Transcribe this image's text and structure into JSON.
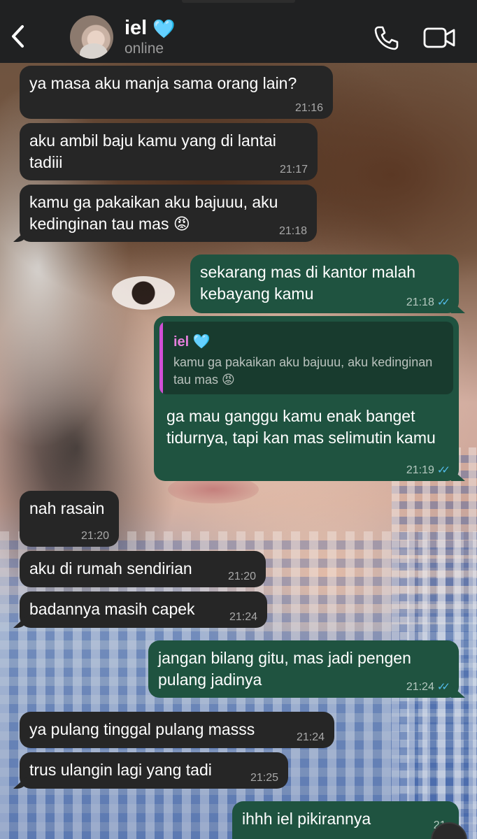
{
  "header": {
    "contact_name": "iel",
    "contact_emoji": "🩵",
    "status": "online",
    "back_icon": "chevron-left-icon",
    "call_icon": "phone-icon",
    "video_icon": "video-camera-icon"
  },
  "messages": [
    {
      "dir": "in",
      "text": "ya masa aku manja sama orang lain?",
      "time": "21:16"
    },
    {
      "dir": "in",
      "text": "aku ambil baju kamu yang di lantai tadiii",
      "time": "21:17"
    },
    {
      "dir": "in",
      "text": "kamu ga pakaikan aku bajuuu, aku kedinginan tau mas 😡",
      "time": "21:18"
    },
    {
      "dir": "out",
      "text": "sekarang mas di kantor malah kebayang kamu",
      "time": "21:18",
      "ticks": "✓✓"
    },
    {
      "dir": "out",
      "reply_name": "iel 🩵",
      "reply_text": "kamu ga pakaikan aku bajuuu, aku kedinginan tau mas 😡",
      "text": "ga mau ganggu kamu enak banget tidurnya, tapi kan mas selimutin kamu",
      "time": "21:19",
      "ticks": "✓✓"
    },
    {
      "dir": "in",
      "text": "nah rasain",
      "time": "21:20"
    },
    {
      "dir": "in",
      "text": "aku di rumah sendirian",
      "time": "21:20"
    },
    {
      "dir": "in",
      "text": "badannya masih capek",
      "time": "21:24"
    },
    {
      "dir": "out",
      "text": "jangan bilang gitu, mas jadi pengen pulang jadinya",
      "time": "21:24",
      "ticks": "✓✓"
    },
    {
      "dir": "in",
      "text": "ya pulang tinggal pulang masss",
      "time": "21:24"
    },
    {
      "dir": "in",
      "text": "trus ulangin lagi yang tadi",
      "time": "21:25"
    },
    {
      "dir": "out",
      "text": "ihhh iel pikirannya",
      "time": "21:"
    }
  ],
  "colors": {
    "header_bg": "#202122",
    "incoming_bubble": "#262626",
    "outgoing_bubble": "#1f5340",
    "read_ticks": "#53bdeb",
    "quote_accent": "#d04fd6"
  }
}
